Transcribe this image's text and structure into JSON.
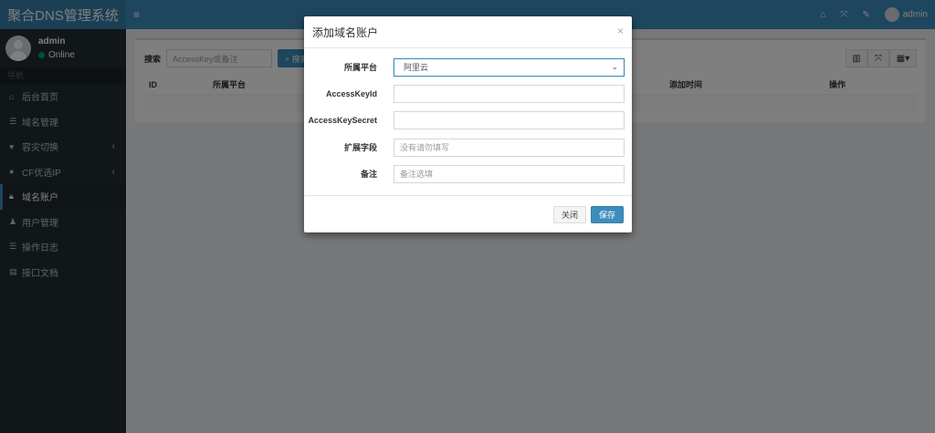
{
  "sidebar": {
    "brand": "聚合DNS管理系统",
    "user": {
      "name": "admin",
      "status": "Online"
    },
    "header": "导航",
    "items": [
      {
        "label": "后台首页",
        "icon": "home-icon"
      },
      {
        "label": "域名管理",
        "icon": "list-icon"
      },
      {
        "label": "容灾切换",
        "icon": "heartbeat-icon",
        "has_children": true
      },
      {
        "label": "CF优选IP",
        "icon": "globe-icon",
        "has_children": true
      },
      {
        "label": "域名账户",
        "icon": "lock-icon",
        "active": true
      },
      {
        "label": "用户管理",
        "icon": "user-icon"
      },
      {
        "label": "操作日志",
        "icon": "list-icon"
      },
      {
        "label": "接口文档",
        "icon": "book-icon"
      }
    ]
  },
  "topbar": {
    "menu_icon": "hamburger-icon",
    "user_name": "admin"
  },
  "main": {
    "search_label": "搜索",
    "search_placeholder": "AccessKey或备注",
    "search_button": "搜索",
    "columns": [
      "ID",
      "所属平台",
      "",
      "添加时间",
      "操作"
    ]
  },
  "modal": {
    "title": "添加域名账户",
    "close": "×",
    "fields": [
      {
        "label": "所属平台",
        "value": "阿里云",
        "placeholder": ""
      },
      {
        "label": "AccessKeyId",
        "value": "",
        "placeholder": ""
      },
      {
        "label": "AccessKeySecret",
        "value": "",
        "placeholder": ""
      },
      {
        "label": "扩展字段",
        "value": "",
        "placeholder": "没有请勿填写"
      },
      {
        "label": "备注",
        "value": "",
        "placeholder": "备注选填"
      }
    ],
    "close_button": "关闭",
    "save_button": "保存"
  },
  "colors": {
    "primary": "#3c8dbc",
    "sidebar": "#222d32",
    "online": "#00a65a"
  }
}
